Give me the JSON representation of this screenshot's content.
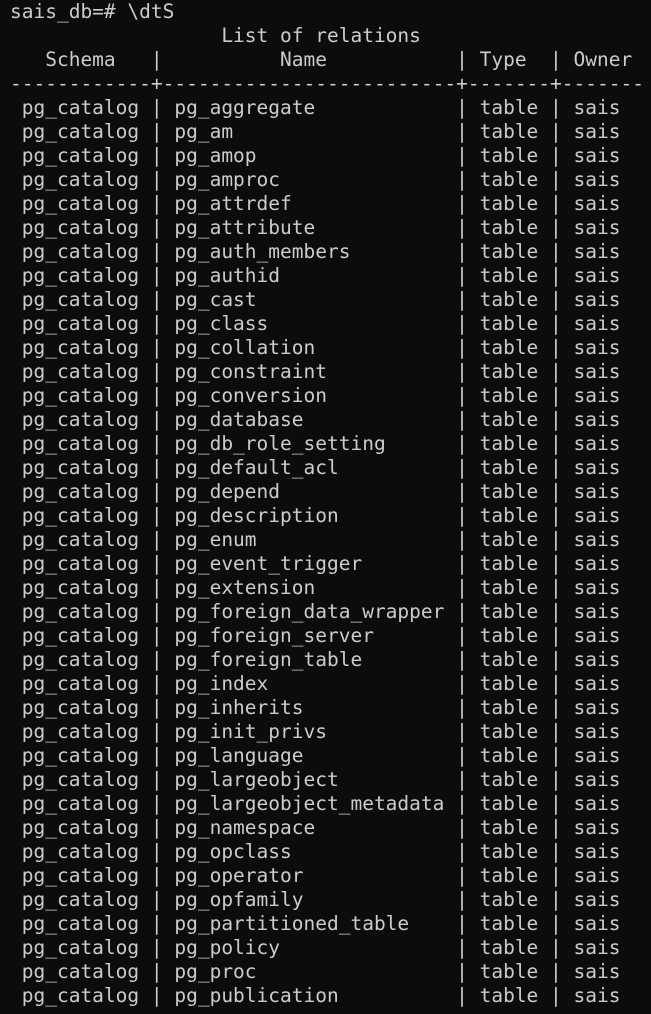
{
  "terminal": {
    "prompt": "sais_db=# ",
    "command": "\\dtS",
    "title": "                  List of relations",
    "header": "   Schema   |          Name           | Type  | Owner",
    "divider": "------------+-------------------------+-------+-------",
    "rows": [
      " pg_catalog | pg_aggregate            | table | sais",
      " pg_catalog | pg_am                   | table | sais",
      " pg_catalog | pg_amop                 | table | sais",
      " pg_catalog | pg_amproc               | table | sais",
      " pg_catalog | pg_attrdef              | table | sais",
      " pg_catalog | pg_attribute            | table | sais",
      " pg_catalog | pg_auth_members         | table | sais",
      " pg_catalog | pg_authid               | table | sais",
      " pg_catalog | pg_cast                 | table | sais",
      " pg_catalog | pg_class                | table | sais",
      " pg_catalog | pg_collation            | table | sais",
      " pg_catalog | pg_constraint           | table | sais",
      " pg_catalog | pg_conversion           | table | sais",
      " pg_catalog | pg_database             | table | sais",
      " pg_catalog | pg_db_role_setting      | table | sais",
      " pg_catalog | pg_default_acl          | table | sais",
      " pg_catalog | pg_depend               | table | sais",
      " pg_catalog | pg_description          | table | sais",
      " pg_catalog | pg_enum                 | table | sais",
      " pg_catalog | pg_event_trigger        | table | sais",
      " pg_catalog | pg_extension            | table | sais",
      " pg_catalog | pg_foreign_data_wrapper | table | sais",
      " pg_catalog | pg_foreign_server       | table | sais",
      " pg_catalog | pg_foreign_table        | table | sais",
      " pg_catalog | pg_index                | table | sais",
      " pg_catalog | pg_inherits             | table | sais",
      " pg_catalog | pg_init_privs           | table | sais",
      " pg_catalog | pg_language             | table | sais",
      " pg_catalog | pg_largeobject          | table | sais",
      " pg_catalog | pg_largeobject_metadata | table | sais",
      " pg_catalog | pg_namespace            | table | sais",
      " pg_catalog | pg_opclass              | table | sais",
      " pg_catalog | pg_operator             | table | sais",
      " pg_catalog | pg_opfamily             | table | sais",
      " pg_catalog | pg_partitioned_table    | table | sais",
      " pg_catalog | pg_policy               | table | sais",
      " pg_catalog | pg_proc                 | table | sais",
      " pg_catalog | pg_publication          | table | sais"
    ]
  },
  "colors": {
    "background": "#0c0c0c",
    "foreground": "#cccccc"
  }
}
